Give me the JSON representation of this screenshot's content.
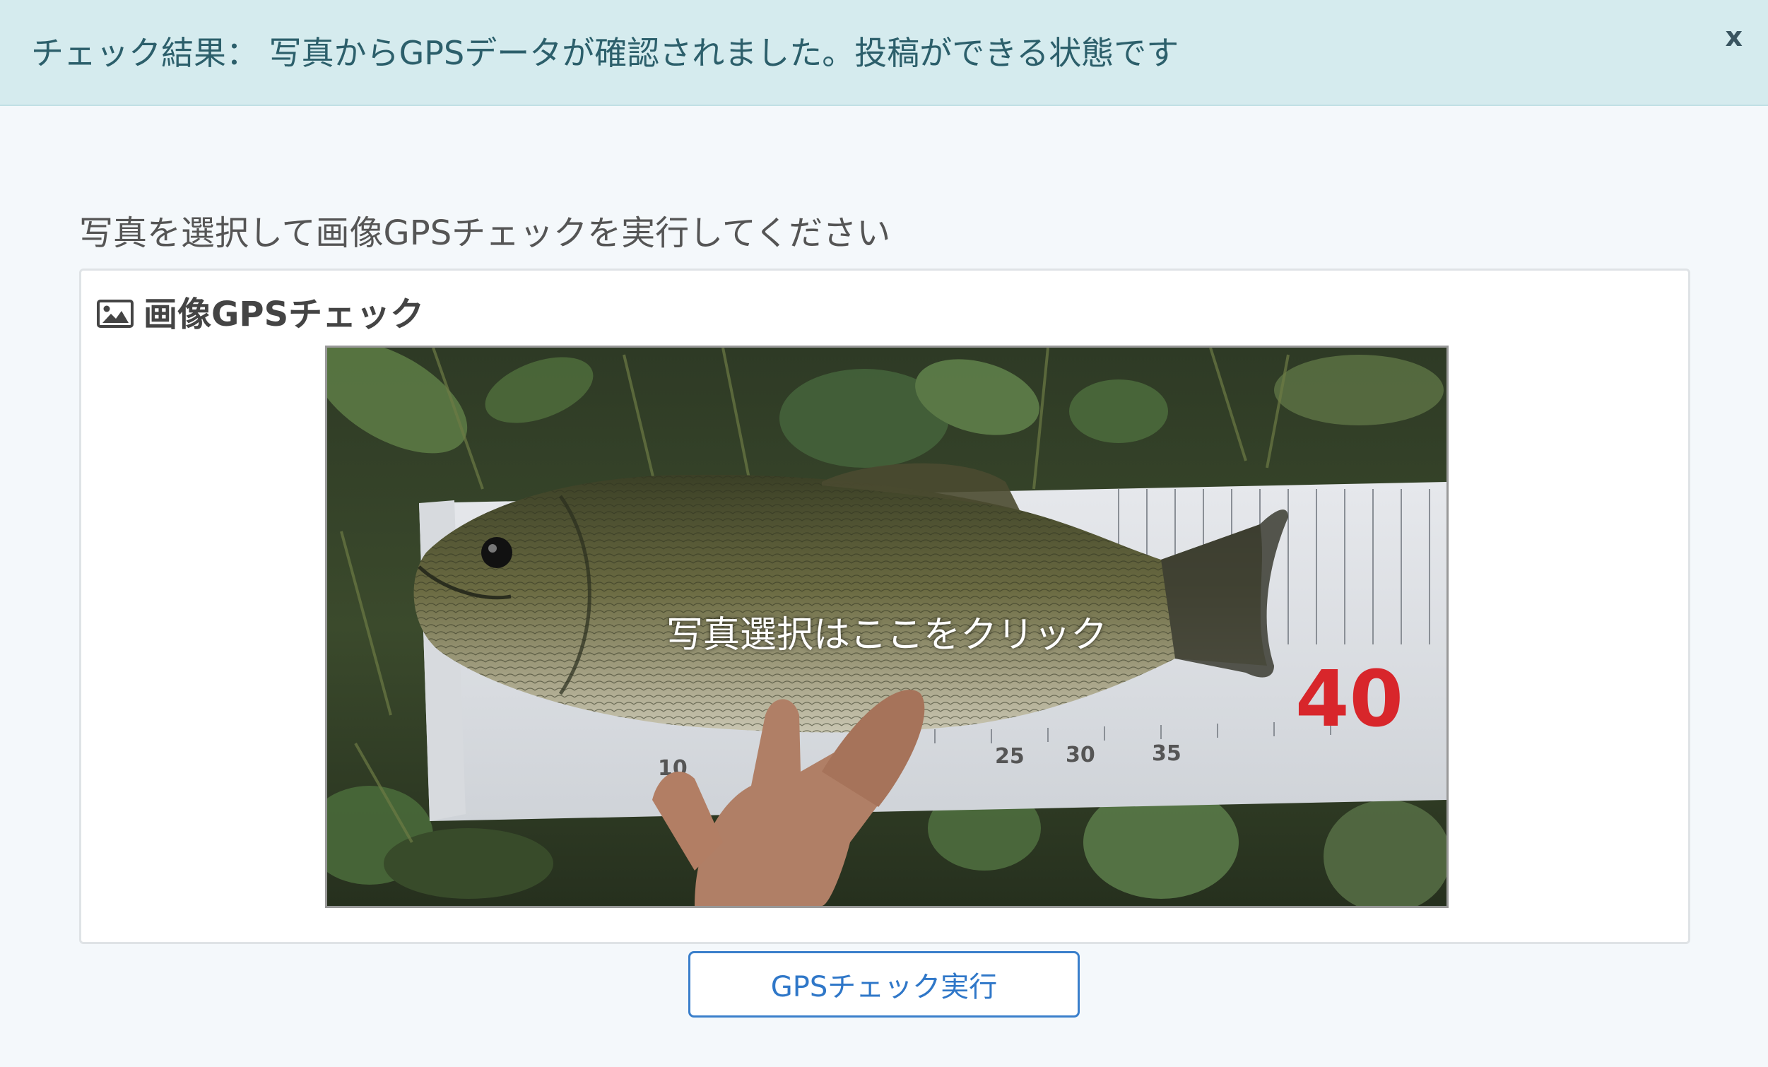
{
  "alert": {
    "message": "チェック結果： 写真からGPSデータが確認されました。投稿ができる状態です",
    "close_label": "x",
    "bg_color": "#d5ebee",
    "text_color": "#2c5f6b"
  },
  "instruction": "写真を選択して画像GPSチェックを実行してください",
  "panel": {
    "title": "画像GPSチェック",
    "icon": "image-icon",
    "photo_caption": "写真選択はここをクリック",
    "photo_subject": "largemouth bass on a measuring board",
    "ruler_labels": [
      "10",
      "25",
      "30",
      "35",
      "40"
    ]
  },
  "actions": {
    "run_label": "GPSチェック実行",
    "accent_color": "#3a7fcb"
  }
}
